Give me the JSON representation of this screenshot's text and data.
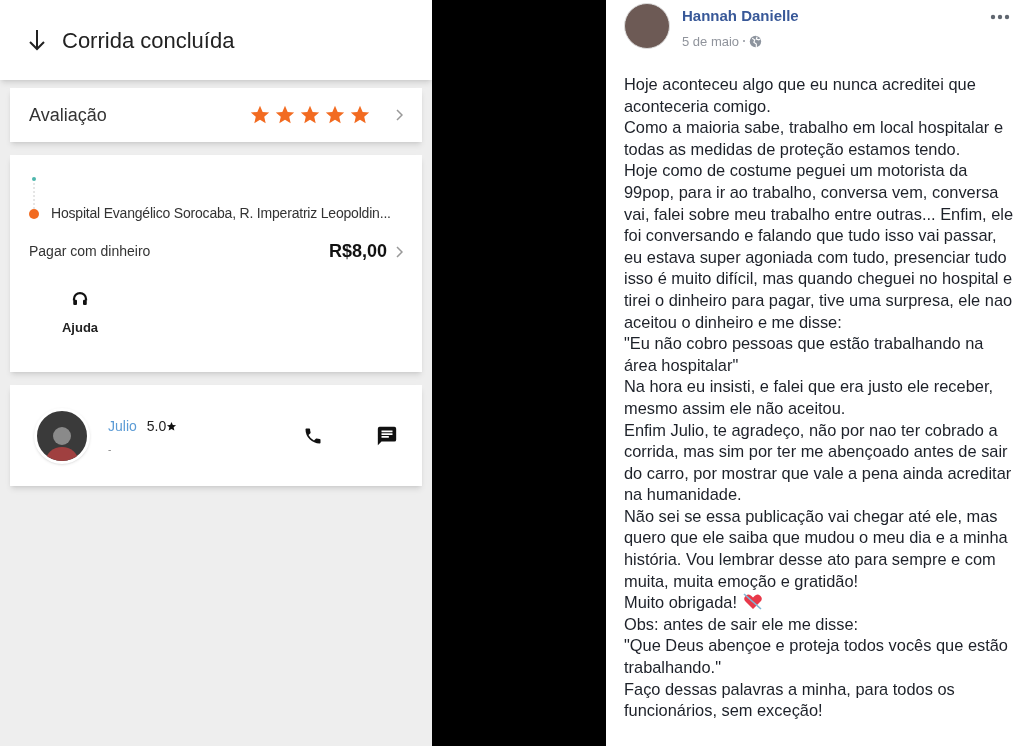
{
  "ride": {
    "title": "Corrida concluída",
    "rating": {
      "label": "Avaliação",
      "stars": 5
    },
    "destination": "Hospital Evangélico Sorocaba, R. Imperatriz Leopoldin...",
    "payment": {
      "label": "Pagar com dinheiro",
      "amount": "R$8,00"
    },
    "help": "Ajuda",
    "driver": {
      "name": "Julio",
      "rating": "5.0",
      "note": "-"
    }
  },
  "post": {
    "author": "Hannah Danielle",
    "date": "5 de maio",
    "paragraphs": [
      {
        "text": "Hoje aconteceu algo que eu nunca acreditei que aconteceria comigo."
      },
      {
        "text": "Como a maioria sabe, trabalho em local hospitalar e todas as medidas de proteção estamos tendo."
      },
      {
        "text": "Hoje como de costume peguei um motorista da 99pop, para ir ao trabalho, conversa vem, conversa vai, falei sobre meu trabalho entre outras... Enfim, ele foi conversando e falando que tudo isso vai passar, eu estava super agoniada com tudo, presenciar tudo isso é muito difícil, mas quando cheguei no hospital e tirei o dinheiro para pagar, tive uma surpresa, ele nao aceitou o dinheiro e me disse:"
      },
      {
        "text": "\"Eu não cobro pessoas que estão trabalhando na área hospitalar\""
      },
      {
        "text": "Na hora eu insisti, e falei que era justo ele receber, mesmo assim ele não aceitou."
      },
      {
        "text": "Enfim Julio, te agradeço, não por nao ter cobrado a corrida, mas sim por ter me abençoado antes de sair do carro, por mostrar que vale a pena ainda acreditar na humanidade."
      },
      {
        "text": "Não sei se essa publicação vai chegar até ele, mas quero que ele saiba que mudou o meu dia e a minha história. Vou lembrar desse ato para sempre e com muita, muita emoção e gratidão!"
      },
      {
        "text": "Muito obrigada!",
        "kind": "heart"
      },
      {
        "text": "Obs: antes de sair ele me disse:"
      },
      {
        "text": "\"Que Deus abençoe e proteja todos vocês que estão trabalhando.\""
      },
      {
        "text": "Faço dessas palavras a minha, para todos os funcionários, sem exceção!"
      }
    ]
  }
}
